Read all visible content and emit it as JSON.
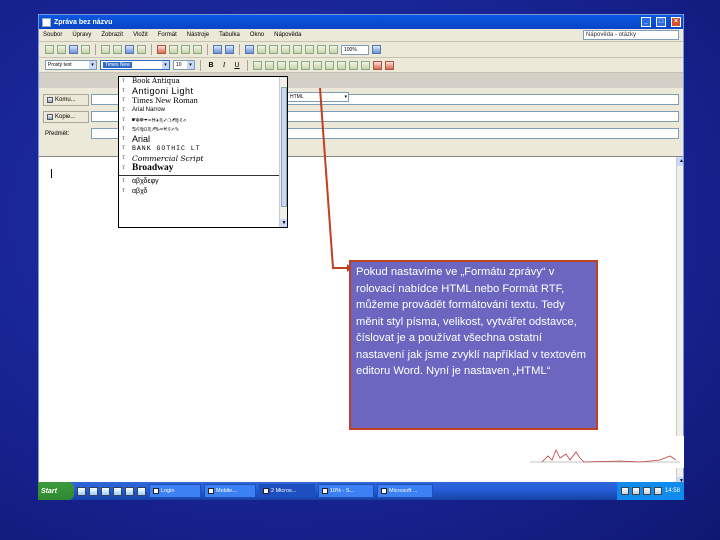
{
  "window": {
    "title": "Zpráva bez názvu"
  },
  "menu": [
    "Soubor",
    "Úpravy",
    "Zobrazit",
    "Vložit",
    "Formát",
    "Nástroje",
    "Tabulka",
    "Okno",
    "Nápověda"
  ],
  "help_box": "Nápověda - otázky",
  "toolbar": {
    "zoom": "100%"
  },
  "formatting": {
    "style": "Prostý text",
    "font": "Times New",
    "size": "10",
    "bold": "B",
    "italic": "I",
    "underline": "U"
  },
  "message_header": {
    "to_button": "Komu...",
    "cc_button": "Kopie...",
    "subject_label": "Předmět:",
    "format_combo": "HTML"
  },
  "font_list": [
    {
      "name": "Book Antiqua",
      "cls": "f1"
    },
    {
      "name": "Antigoni Light",
      "cls": "f2"
    },
    {
      "name": "Times New Roman",
      "cls": "f3"
    },
    {
      "name": "Arial Narrow",
      "cls": "f4"
    },
    {
      "name": "☛❄☸☂♒♓✈♏✓❍♐♍✌✍",
      "cls": "f5"
    },
    {
      "name": "♋♌♍♎♏♐♑♒♓✌✍✎",
      "cls": "f5"
    },
    {
      "name": "Arial",
      "cls": "f7"
    },
    {
      "name": "BANK GOTHIC LT",
      "cls": "f8"
    },
    {
      "name": "Commercial Script",
      "cls": "f9"
    },
    {
      "name": "Broadway",
      "cls": "f10"
    },
    {
      "name": "αβχδεφγ",
      "cls": "f11"
    },
    {
      "name": "αβχδ",
      "cls": "f12"
    }
  ],
  "callout": {
    "text": "Pokud nastavíme ve „Formátu zprávy“ v rolovací nabídce HTML nebo Formát RTF, můžeme provádět formátování textu. Tedy měnit styl písma, velikost, vytvářet odstavce, číslovat je a používat všechna ostatní nastavení jak jsme zvyklí například v textovém editoru Word. Nyní je nastaven „HTML“"
  },
  "taskbar": {
    "start": "Start",
    "tasks": [
      "Login",
      "Mobile...",
      "2 Micros...",
      "10% - S...",
      "Microsoft ..."
    ],
    "clock": "14:58"
  },
  "colors": {
    "slide": "#1c2a9c",
    "callout_bg": "#6b67c0",
    "callout_border": "#c04020",
    "selection": "#316ac5"
  }
}
